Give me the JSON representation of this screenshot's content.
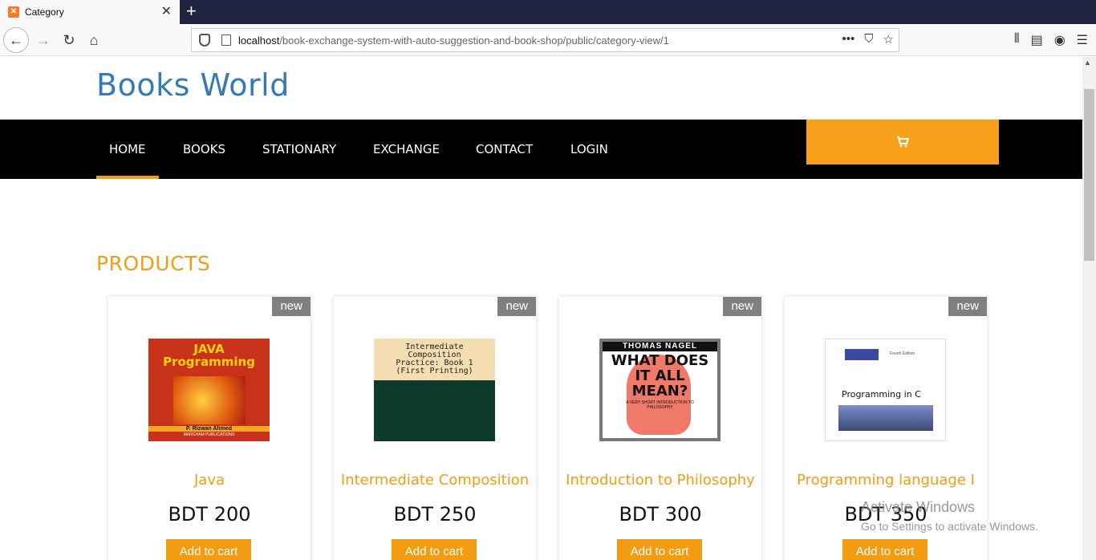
{
  "browser": {
    "tab_title": "Category",
    "url_host": "localhost",
    "url_path": "/book-exchange-system-with-auto-suggestion-and-book-shop/public/category-view/1"
  },
  "site": {
    "brand": "Books World",
    "nav": [
      {
        "label": "HOME"
      },
      {
        "label": "BOOKS"
      },
      {
        "label": "STATIONARY"
      },
      {
        "label": "EXCHANGE"
      },
      {
        "label": "CONTACT"
      },
      {
        "label": "LOGIN"
      }
    ],
    "cart_icon": "cart-icon",
    "accent": "#f39c12"
  },
  "products": {
    "heading": "PRODUCTS",
    "items": [
      {
        "badge": "new",
        "title": "Java",
        "price": "BDT 200",
        "button": "Add to cart",
        "cover_lines": [
          "JAVA",
          "Programming",
          "P. Rizwan Ahmed",
          "MARGHAM PUBLICATIONS"
        ]
      },
      {
        "badge": "new",
        "title": "Intermediate Composition",
        "price": "BDT 250",
        "button": "Add to cart",
        "cover_lines": [
          "Intermediate",
          "Composition",
          "Practice: Book 1",
          "(First Printing)"
        ]
      },
      {
        "badge": "new",
        "title": "Introduction to Philosophy",
        "price": "BDT 300",
        "button": "Add to cart",
        "cover_lines": [
          "THOMAS NAGEL",
          "WHAT DOES",
          "IT ALL",
          "MEAN?",
          "A VERY SHORT INTRODUCTION TO PHILOSOPHY"
        ]
      },
      {
        "badge": "new",
        "title": "Programming language I",
        "price": "BDT 350",
        "button": "Add to cart",
        "cover_lines": [
          "Programming in C",
          "Fourth Edition"
        ]
      }
    ]
  },
  "os_overlay": {
    "line1": "Activate Windows",
    "line2": "Go to Settings to activate Windows."
  }
}
